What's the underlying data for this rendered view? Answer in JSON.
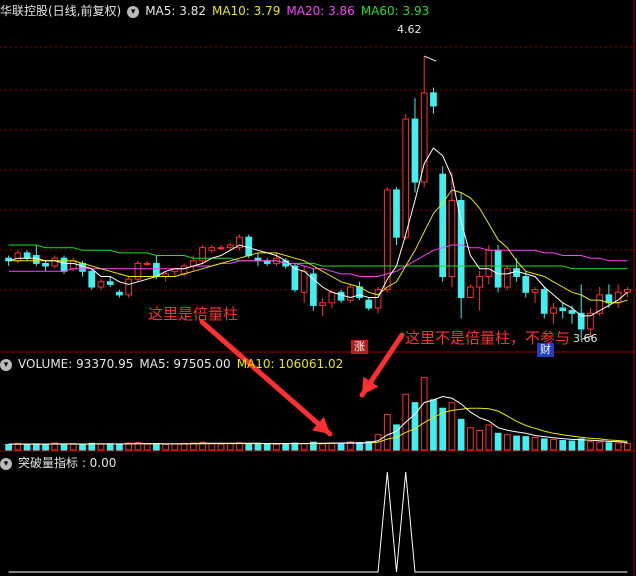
{
  "header": {
    "title": "华联控股(日线,前复权)",
    "ma5_label": "MA5: 3.82",
    "ma10_label": "MA10: 3.79",
    "ma20_label": "MA20: 3.86",
    "ma60_label": "MA60: 3.93"
  },
  "volume_header": {
    "volume_label": "VOLUME: 93370.95",
    "ma5_label": "MA5: 97505.00",
    "ma10_label": "MA10: 106061.02"
  },
  "indicator_header": {
    "label": "突破量指标 : 0.00"
  },
  "annotations": {
    "left": "这里是倍量柱",
    "right": "这里不是倍量柱，不参与",
    "tag_zhang": "涨",
    "tag_cai": "财",
    "high_label": "4.62",
    "low_label": "3.66"
  },
  "colors": {
    "up": "#ff3030",
    "down": "#40f0f0",
    "ma5": "#ffffff",
    "ma10": "#e8e800",
    "ma20": "#ff40ff",
    "ma60": "#20e020",
    "arrow": "#ff3030",
    "grid": "#8b0000"
  },
  "chart_data": [
    {
      "type": "candlestick",
      "title": "华联控股(日线,前复权)",
      "ylim": [
        3.5,
        4.75
      ],
      "ohlc": [
        [
          3.85,
          3.86,
          3.82,
          3.84
        ],
        [
          3.84,
          3.88,
          3.83,
          3.87
        ],
        [
          3.87,
          3.88,
          3.84,
          3.85
        ],
        [
          3.86,
          3.9,
          3.82,
          3.83
        ],
        [
          3.83,
          3.84,
          3.8,
          3.82
        ],
        [
          3.82,
          3.86,
          3.81,
          3.85
        ],
        [
          3.85,
          3.86,
          3.79,
          3.8
        ],
        [
          3.81,
          3.85,
          3.8,
          3.84
        ],
        [
          3.83,
          3.84,
          3.78,
          3.8
        ],
        [
          3.8,
          3.81,
          3.73,
          3.74
        ],
        [
          3.74,
          3.77,
          3.73,
          3.76
        ],
        [
          3.76,
          3.78,
          3.74,
          3.75
        ],
        [
          3.72,
          3.73,
          3.7,
          3.71
        ],
        [
          3.71,
          3.78,
          3.7,
          3.77
        ],
        [
          3.77,
          3.84,
          3.76,
          3.83
        ],
        [
          3.83,
          3.84,
          3.82,
          3.83
        ],
        [
          3.83,
          3.86,
          3.77,
          3.78
        ],
        [
          3.78,
          3.8,
          3.76,
          3.79
        ],
        [
          3.8,
          3.81,
          3.78,
          3.81
        ],
        [
          3.79,
          3.83,
          3.78,
          3.82
        ],
        [
          3.82,
          3.86,
          3.8,
          3.84
        ],
        [
          3.84,
          3.9,
          3.83,
          3.89
        ],
        [
          3.88,
          3.9,
          3.87,
          3.89
        ],
        [
          3.89,
          3.9,
          3.88,
          3.89
        ],
        [
          3.89,
          3.91,
          3.88,
          3.9
        ],
        [
          3.89,
          3.94,
          3.88,
          3.93
        ],
        [
          3.93,
          3.94,
          3.85,
          3.86
        ],
        [
          3.85,
          3.87,
          3.82,
          3.84
        ],
        [
          3.84,
          3.85,
          3.82,
          3.83
        ],
        [
          3.83,
          3.87,
          3.82,
          3.85
        ],
        [
          3.84,
          3.85,
          3.81,
          3.82
        ],
        [
          3.82,
          3.83,
          3.72,
          3.73
        ],
        [
          3.72,
          3.82,
          3.68,
          3.8
        ],
        [
          3.79,
          3.81,
          3.65,
          3.67
        ],
        [
          3.67,
          3.7,
          3.63,
          3.68
        ],
        [
          3.68,
          3.73,
          3.66,
          3.72
        ],
        [
          3.72,
          3.73,
          3.68,
          3.69
        ],
        [
          3.69,
          3.75,
          3.68,
          3.74
        ],
        [
          3.74,
          3.76,
          3.69,
          3.7
        ],
        [
          3.69,
          3.7,
          3.65,
          3.66
        ],
        [
          3.66,
          3.74,
          3.64,
          3.73
        ],
        [
          3.73,
          4.12,
          3.72,
          4.11
        ],
        [
          4.11,
          4.12,
          3.9,
          3.93
        ],
        [
          3.93,
          4.4,
          3.92,
          4.38
        ],
        [
          4.38,
          4.46,
          4.1,
          4.14
        ],
        [
          4.14,
          4.62,
          4.12,
          4.48
        ],
        [
          4.48,
          4.5,
          4.4,
          4.43
        ],
        [
          4.17,
          4.2,
          3.76,
          3.78
        ],
        [
          3.78,
          4.18,
          3.74,
          4.07
        ],
        [
          4.07,
          4.1,
          3.62,
          3.7
        ],
        [
          3.7,
          3.75,
          3.7,
          3.74
        ],
        [
          3.74,
          3.8,
          3.65,
          3.78
        ],
        [
          3.78,
          3.9,
          3.75,
          3.88
        ],
        [
          3.88,
          3.9,
          3.72,
          3.74
        ],
        [
          3.74,
          3.82,
          3.73,
          3.81
        ],
        [
          3.81,
          3.85,
          3.76,
          3.78
        ],
        [
          3.78,
          3.8,
          3.7,
          3.72
        ],
        [
          3.72,
          3.74,
          3.68,
          3.73
        ],
        [
          3.73,
          3.74,
          3.62,
          3.64
        ],
        [
          3.64,
          3.68,
          3.6,
          3.66
        ],
        [
          3.66,
          3.68,
          3.62,
          3.65
        ],
        [
          3.65,
          3.67,
          3.6,
          3.64
        ],
        [
          3.64,
          3.75,
          3.54,
          3.58
        ],
        [
          3.58,
          3.66,
          3.55,
          3.64
        ],
        [
          3.64,
          3.74,
          3.63,
          3.71
        ],
        [
          3.71,
          3.75,
          3.66,
          3.68
        ],
        [
          3.68,
          3.75,
          3.66,
          3.72
        ],
        [
          3.72,
          3.74,
          3.7,
          3.73
        ]
      ],
      "ma5": [
        3.84,
        3.85,
        3.85,
        3.85,
        3.84,
        3.84,
        3.83,
        3.83,
        3.82,
        3.81,
        3.78,
        3.78,
        3.76,
        3.75,
        3.76,
        3.77,
        3.78,
        3.8,
        3.81,
        3.81,
        3.82,
        3.83,
        3.85,
        3.86,
        3.88,
        3.9,
        3.89,
        3.88,
        3.87,
        3.86,
        3.84,
        3.81,
        3.8,
        3.77,
        3.74,
        3.72,
        3.71,
        3.7,
        3.71,
        3.7,
        3.7,
        3.77,
        3.82,
        3.94,
        4.07,
        4.21,
        4.27,
        4.24,
        4.16,
        3.99,
        3.86,
        3.81,
        3.81,
        3.79,
        3.79,
        3.8,
        3.79,
        3.78,
        3.74,
        3.71,
        3.68,
        3.66,
        3.63,
        3.63,
        3.65,
        3.67,
        3.69,
        3.72
      ],
      "ma10": [
        3.84,
        3.84,
        3.84,
        3.84,
        3.84,
        3.84,
        3.84,
        3.84,
        3.83,
        3.82,
        3.81,
        3.8,
        3.79,
        3.78,
        3.78,
        3.78,
        3.78,
        3.78,
        3.78,
        3.79,
        3.8,
        3.81,
        3.82,
        3.83,
        3.84,
        3.85,
        3.86,
        3.87,
        3.87,
        3.87,
        3.86,
        3.85,
        3.84,
        3.82,
        3.8,
        3.78,
        3.76,
        3.75,
        3.74,
        3.72,
        3.71,
        3.74,
        3.76,
        3.82,
        3.88,
        3.95,
        4.02,
        4.06,
        4.11,
        4.1,
        4.08,
        4.04,
        3.98,
        3.92,
        3.89,
        3.84,
        3.8,
        3.79,
        3.78,
        3.76,
        3.74,
        3.72,
        3.71,
        3.69,
        3.69,
        3.68,
        3.68,
        3.69
      ],
      "ma20": [
        3.8,
        3.8,
        3.8,
        3.8,
        3.8,
        3.8,
        3.8,
        3.81,
        3.81,
        3.81,
        3.81,
        3.81,
        3.81,
        3.81,
        3.81,
        3.81,
        3.81,
        3.81,
        3.81,
        3.81,
        3.82,
        3.82,
        3.82,
        3.83,
        3.83,
        3.84,
        3.84,
        3.84,
        3.84,
        3.84,
        3.83,
        3.83,
        3.82,
        3.81,
        3.81,
        3.8,
        3.79,
        3.79,
        3.78,
        3.78,
        3.78,
        3.79,
        3.8,
        3.82,
        3.84,
        3.86,
        3.88,
        3.89,
        3.9,
        3.9,
        3.89,
        3.89,
        3.88,
        3.88,
        3.88,
        3.88,
        3.88,
        3.88,
        3.87,
        3.87,
        3.86,
        3.86,
        3.86,
        3.85,
        3.85,
        3.84,
        3.84,
        3.84
      ],
      "ma60": [
        3.9,
        3.9,
        3.9,
        3.9,
        3.89,
        3.89,
        3.89,
        3.89,
        3.88,
        3.88,
        3.88,
        3.88,
        3.87,
        3.87,
        3.87,
        3.87,
        3.86,
        3.86,
        3.86,
        3.86,
        3.85,
        3.85,
        3.85,
        3.85,
        3.85,
        3.84,
        3.84,
        3.84,
        3.84,
        3.84,
        3.83,
        3.83,
        3.83,
        3.83,
        3.82,
        3.82,
        3.82,
        3.82,
        3.82,
        3.82,
        3.82,
        3.82,
        3.82,
        3.82,
        3.82,
        3.82,
        3.82,
        3.82,
        3.82,
        3.82,
        3.82,
        3.82,
        3.82,
        3.82,
        3.82,
        3.82,
        3.82,
        3.82,
        3.82,
        3.82,
        3.82,
        3.81,
        3.81,
        3.81,
        3.81,
        3.81,
        3.81,
        3.81
      ]
    },
    {
      "type": "bar",
      "title": "VOLUME",
      "ylim": [
        0,
        280000
      ],
      "values": [
        20000,
        24000,
        19000,
        22000,
        21000,
        25000,
        18000,
        23000,
        20000,
        24000,
        21000,
        22000,
        19000,
        25000,
        27000,
        21000,
        23000,
        20000,
        22000,
        24000,
        25000,
        28000,
        22000,
        21000,
        23000,
        26000,
        22000,
        24000,
        21000,
        20000,
        22000,
        25000,
        24000,
        28000,
        22000,
        23000,
        24000,
        29000,
        27000,
        30000,
        55000,
        128000,
        90000,
        200000,
        170000,
        260000,
        180000,
        150000,
        170000,
        110000,
        80000,
        70000,
        90000,
        60000,
        55000,
        50000,
        48000,
        45000,
        40000,
        38000,
        34000,
        32000,
        40000,
        30000,
        28000,
        26000,
        25000,
        23000
      ],
      "ma5": [
        21000,
        21000,
        21000,
        21000,
        21000,
        22000,
        22000,
        22000,
        21000,
        22000,
        22000,
        22000,
        21000,
        22000,
        23000,
        23000,
        23000,
        22000,
        22000,
        22000,
        23000,
        24000,
        24000,
        24000,
        24000,
        24000,
        24000,
        24000,
        23000,
        23000,
        23000,
        23000,
        23000,
        24000,
        24000,
        25000,
        25000,
        26000,
        25000,
        27000,
        33000,
        54000,
        67000,
        100000,
        129000,
        170000,
        180000,
        192000,
        186000,
        166000,
        136000,
        116000,
        104000,
        80000,
        71000,
        65000,
        60000,
        52000,
        48000,
        44000,
        41000,
        38000,
        37000,
        35000,
        33000,
        31000,
        30000,
        26000
      ],
      "ma10": [
        21000,
        21000,
        21000,
        21000,
        21000,
        21000,
        21000,
        21000,
        21000,
        21000,
        22000,
        22000,
        22000,
        22000,
        22000,
        22000,
        22000,
        22000,
        22000,
        22000,
        22000,
        22000,
        23000,
        23000,
        23000,
        23000,
        23000,
        23000,
        23000,
        23000,
        23000,
        23000,
        23000,
        23000,
        23000,
        24000,
        24000,
        24000,
        24000,
        25000,
        28000,
        39000,
        46000,
        63000,
        77000,
        98000,
        117000,
        133000,
        142000,
        146000,
        150000,
        150000,
        148000,
        140000,
        122000,
        103000,
        88000,
        78000,
        68000,
        60000,
        55000,
        50000,
        46000,
        42000,
        40000,
        36000,
        34000,
        31000
      ]
    },
    {
      "type": "line",
      "title": "突破量指标",
      "ylim": [
        0,
        1
      ],
      "values": [
        0,
        0,
        0,
        0,
        0,
        0,
        0,
        0,
        0,
        0,
        0,
        0,
        0,
        0,
        0,
        0,
        0,
        0,
        0,
        0,
        0,
        0,
        0,
        0,
        0,
        0,
        0,
        0,
        0,
        0,
        0,
        0,
        0,
        0,
        0,
        0,
        0,
        0,
        0,
        0,
        0,
        1,
        0,
        1,
        0,
        0,
        0,
        0,
        0,
        0,
        0,
        0,
        0,
        0,
        0,
        0,
        0,
        0,
        0,
        0,
        0,
        0,
        0,
        0,
        0,
        0,
        0,
        0
      ]
    }
  ]
}
